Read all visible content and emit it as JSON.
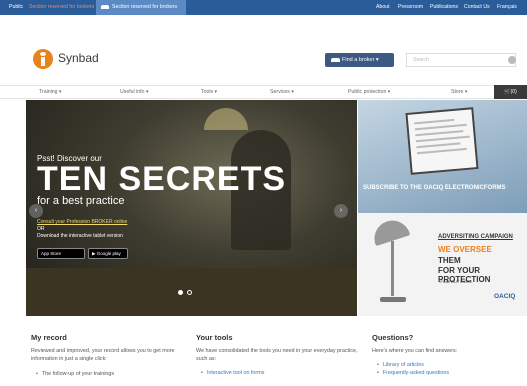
{
  "topbar": {
    "public": "Public",
    "reserved_muted": "Section reserved for brokers",
    "broker": "Section reserved for brokers",
    "links": [
      "About",
      "Pressroom",
      "Publications",
      "Contact Us",
      "Français"
    ]
  },
  "brand": {
    "name": "Synbad",
    "accent": "#e8821e"
  },
  "header": {
    "find_broker": "Find a broker ▾",
    "search_placeholder": "Search"
  },
  "nav": [
    "Training ▾",
    "Useful info ▾",
    "Tools ▾",
    "Services ▾",
    "Public protection ▾",
    "Store ▾"
  ],
  "cart": "(0)",
  "hero": {
    "small": "Psst! Discover our",
    "big": "TEN SECRETS",
    "sub": "for a best practice",
    "link": "Consult your Profession BROKER online",
    "or": "OR",
    "download": "Download the interactive tablet version",
    "app_store": " App Store",
    "google_play": "▶ Google play"
  },
  "ad_top": {
    "caption": "SUBSCRIBE TO THE OACIQ ELECTRONICFORMS"
  },
  "ad_bottom": {
    "t1": "ADVERSITING CAMPAIGN",
    "t2": "WE OVERSEE",
    "t3": "THEM",
    "t4": "FOR YOUR PROTECTION",
    "t5": "+FIND OUT MORE",
    "brand": "OACIQ"
  },
  "columns": [
    {
      "title": "My record",
      "body": "Reviewed and improved, your record allows you to get more information in just a single click:",
      "items": [
        "The follow-up of your trainings"
      ]
    },
    {
      "title": "Your tools",
      "body": "We have consolidated the tools you need in your everyday practice, such as:",
      "items": [
        "Interactive tool on forms"
      ]
    },
    {
      "title": "Questions?",
      "body": "Here's where you can find answers:",
      "items": [
        "Library of articles",
        "Frequently-asked questions"
      ]
    }
  ]
}
